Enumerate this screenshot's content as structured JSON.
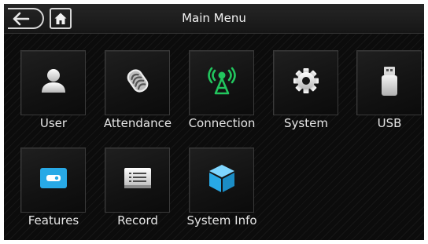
{
  "header": {
    "title": "Main Menu",
    "back_icon": "back-arrow-icon",
    "home_icon": "home-icon"
  },
  "menu": {
    "user": {
      "label": "User",
      "icon": "user-icon"
    },
    "attendance": {
      "label": "Attendance",
      "icon": "fingerprint-icon"
    },
    "connection": {
      "label": "Connection",
      "icon": "wireless-antenna-icon"
    },
    "system": {
      "label": "System",
      "icon": "gear-icon"
    },
    "usb": {
      "label": "USB",
      "icon": "usb-drive-icon"
    },
    "features": {
      "label": "Features",
      "icon": "card-icon"
    },
    "record": {
      "label": "Record",
      "icon": "list-icon"
    },
    "system_info": {
      "label": "System Info",
      "icon": "cube-icon"
    }
  },
  "colors": {
    "background": "#0c0c0c",
    "accent_green": "#22c55e",
    "accent_blue": "#28a9e6",
    "text": "#e6e6e6"
  }
}
